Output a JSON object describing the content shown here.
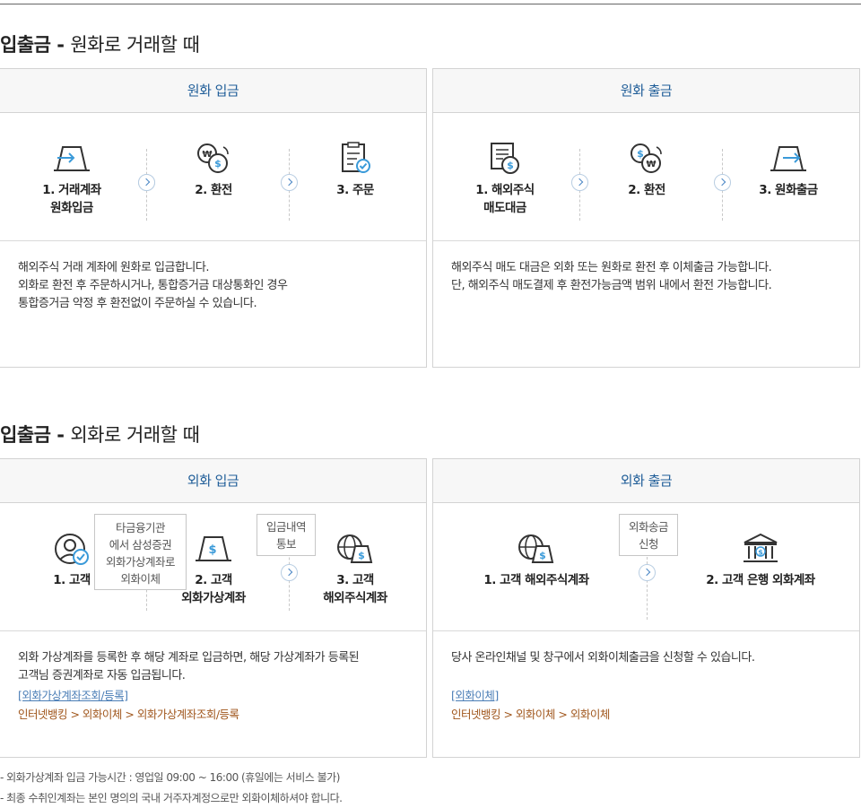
{
  "section1": {
    "title_bold": "입출금",
    "separator": " - ",
    "title_rest": "원화로 거래할 때"
  },
  "section2": {
    "title_bold": "입출금",
    "separator": " - ",
    "title_rest": "외화로 거래할 때"
  },
  "krw_deposit": {
    "header": "원화 입금",
    "steps": [
      {
        "line1": "1. 거래계좌",
        "line2": "원화입금",
        "icon": "card-in-icon"
      },
      {
        "line1": "2. 환전",
        "line2": "",
        "icon": "exchange-icon"
      },
      {
        "line1": "3. 주문",
        "line2": "",
        "icon": "order-icon"
      }
    ],
    "desc": [
      "해외주식 거래 계좌에 원화로 입금합니다.",
      "외화로 환전 후 주문하시거나, 통합증거금 대상통화인 경우",
      "통합증거금 약정 후 환전없이 주문하실 수 있습니다."
    ]
  },
  "krw_withdraw": {
    "header": "원화 출금",
    "steps": [
      {
        "line1": "1. 해외주식",
        "line2": "매도대금",
        "icon": "stock-sale-icon"
      },
      {
        "line1": "2. 환전",
        "line2": "",
        "icon": "exchange-icon"
      },
      {
        "line1": "3. 원화출금",
        "line2": "",
        "icon": "card-out-icon"
      }
    ],
    "desc": [
      "해외주식 매도 대금은 외화 또는 원화로 환전 후 이체출금 가능합니다.",
      "단, 해외주식 매도결제 후 환전가능금액 범위 내에서 환전 가능합니다."
    ]
  },
  "fx_deposit": {
    "header": "외화 입금",
    "steps": [
      {
        "line1": "1. 고객",
        "line2": "",
        "icon": "customer-icon"
      },
      {
        "line1": "2. 고객",
        "line2": "외화가상계좌",
        "icon": "virtual-account-icon"
      },
      {
        "line1": "3. 고객",
        "line2": "해외주식계좌",
        "icon": "global-account-icon"
      }
    ],
    "note1": [
      "타금융기관",
      "에서 삼성증권",
      "외화가상계좌로",
      "외화이체"
    ],
    "note2": [
      "입금내역",
      "통보"
    ],
    "desc": [
      "외화 가상계좌를 등록한 후 해당 계좌로 입금하면, 해당 가상계좌가 등록된",
      "고객님 증권계좌로 자동 입금됩니다."
    ],
    "link": "[외화가상계좌조회/등록]",
    "path": "인터넷뱅킹 > 외화이체 > 외화가상계좌조회/등록"
  },
  "fx_withdraw": {
    "header": "외화 출금",
    "steps": [
      {
        "line1": "1. 고객 해외주식계좌",
        "line2": "",
        "icon": "global-account-icon"
      },
      {
        "line1": "2. 고객 은행 외화계좌",
        "line2": "",
        "icon": "bank-icon"
      }
    ],
    "note": [
      "외화송금",
      "신청"
    ],
    "desc": [
      "당사 온라인채널 및 창구에서 외화이체출금을 신청할 수 있습니다."
    ],
    "link": "[외화이체]",
    "path": "인터넷뱅킹 > 외화이체 > 외화이체"
  },
  "footnotes": [
    "- 외화가상계좌 입금 가능시간 : 영업일 09:00 ~ 16:00 (휴일에는 서비스 불가)",
    "- 최종 수취인계좌는 본인 명의의 국내 거주자계정으로만 외화이체하셔야 합니다."
  ],
  "colors": {
    "accent": "#1f5d98",
    "icon_blue": "#3a9ad9",
    "link": "#4a7db6",
    "path": "#a0561c"
  }
}
